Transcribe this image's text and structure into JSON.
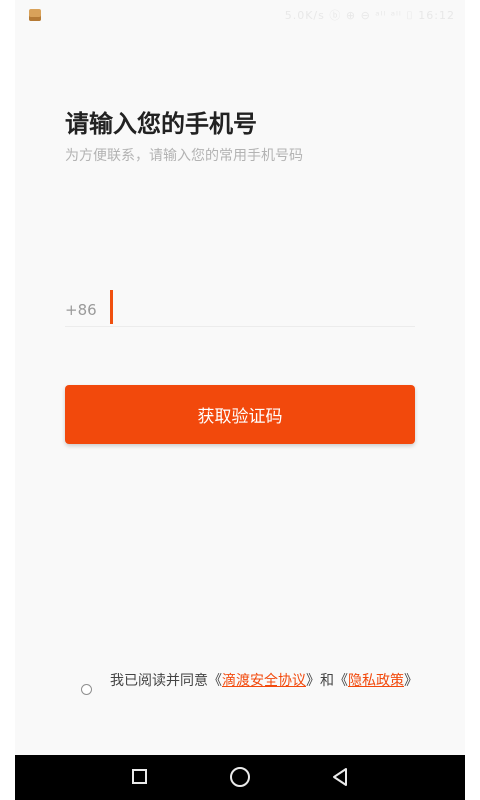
{
  "status_bar": {
    "app_icon": "app-notification-icon",
    "right_text": "5.0K/s ⓑ ⊕ ⊖ ᵃˡˡ ᵃˡˡ ⌷ 16:12"
  },
  "header": {
    "title": "请输入您的手机号",
    "subtitle": "为方便联系，请输入您的常用手机号码"
  },
  "phone_input": {
    "country_code": "+86",
    "value": "",
    "placeholder": ""
  },
  "actions": {
    "get_code_label": "获取验证码"
  },
  "agreement": {
    "prefix": "我已阅读并同意《",
    "link1": "滴渡安全协议",
    "middle": "》和《",
    "link2": "隐私政策",
    "suffix": "》",
    "checked": false
  },
  "nav_bar": {
    "recent_icon": "square-icon",
    "home_icon": "circle-icon",
    "back_icon": "triangle-back-icon"
  },
  "colors": {
    "accent": "#f2490c",
    "background": "#f9f9f9",
    "title": "#222222",
    "subtitle": "#b3b3b3"
  }
}
